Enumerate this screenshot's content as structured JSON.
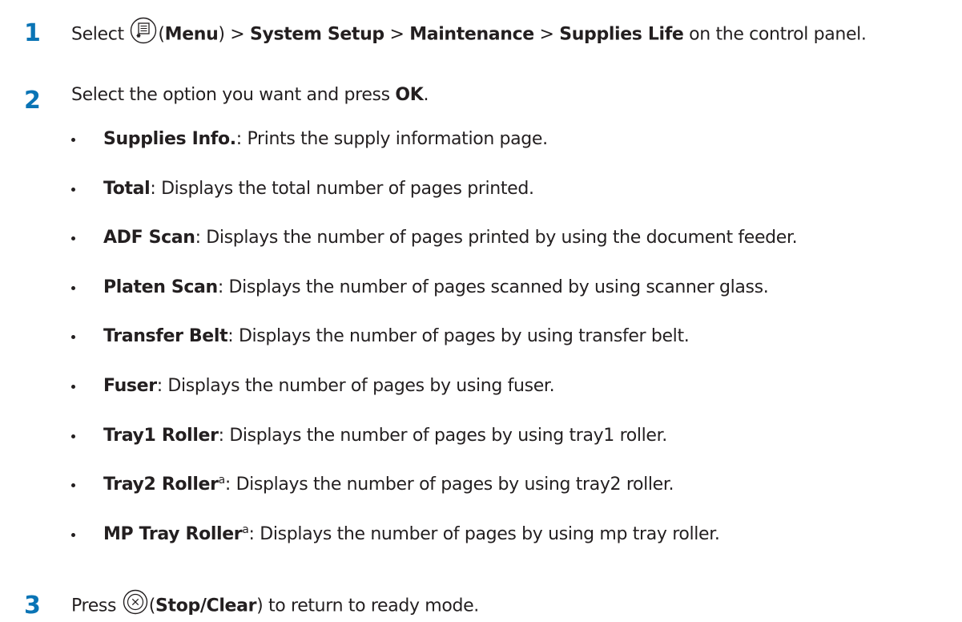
{
  "steps": [
    {
      "number": "1",
      "prefix": "Select ",
      "icon": "menu-icon",
      "open_paren": "(",
      "menu_label": "Menu",
      "close_paren": ")",
      "sep1": " > ",
      "path1": "System Setup",
      "sep2": " > ",
      "path2": "Maintenance",
      "sep3": " > ",
      "path3": "Supplies Life",
      "suffix": " on the control panel."
    },
    {
      "number": "2",
      "prefix": "Select the option you want and press ",
      "ok_label": "OK",
      "suffix": "."
    },
    {
      "number": "3",
      "prefix": "Press ",
      "icon": "stop-clear-icon",
      "open_paren": "(",
      "button_label": "Stop/Clear",
      "suffix": ") to return to ready mode."
    }
  ],
  "options": [
    {
      "name": "Supplies Info.",
      "sup": "",
      "desc": ": Prints the supply information page."
    },
    {
      "name": "Total",
      "sup": "",
      "desc": ": Displays the total number of pages printed."
    },
    {
      "name": "ADF Scan",
      "sup": "",
      "desc": ": Displays the number of pages printed by using the document feeder."
    },
    {
      "name": "Platen Scan",
      "sup": "",
      "desc": ": Displays the number of pages scanned by using scanner glass."
    },
    {
      "name": "Transfer Belt",
      "sup": "",
      "desc": ": Displays the number of pages by using transfer belt."
    },
    {
      "name": "Fuser",
      "sup": "",
      "desc": ": Displays the number of pages by using fuser."
    },
    {
      "name": "Tray1 Roller",
      "sup": "",
      "desc": ": Displays the number of pages by using tray1 roller."
    },
    {
      "name": "Tray2 Roller",
      "sup": "a",
      "desc": ": Displays the number of pages by using tray2 roller."
    },
    {
      "name": "MP Tray Roller",
      "sup": "a",
      "desc": ": Displays the number of pages by using mp tray roller."
    }
  ],
  "colors": {
    "step_number": "#0a74b5",
    "text": "#231f20"
  }
}
